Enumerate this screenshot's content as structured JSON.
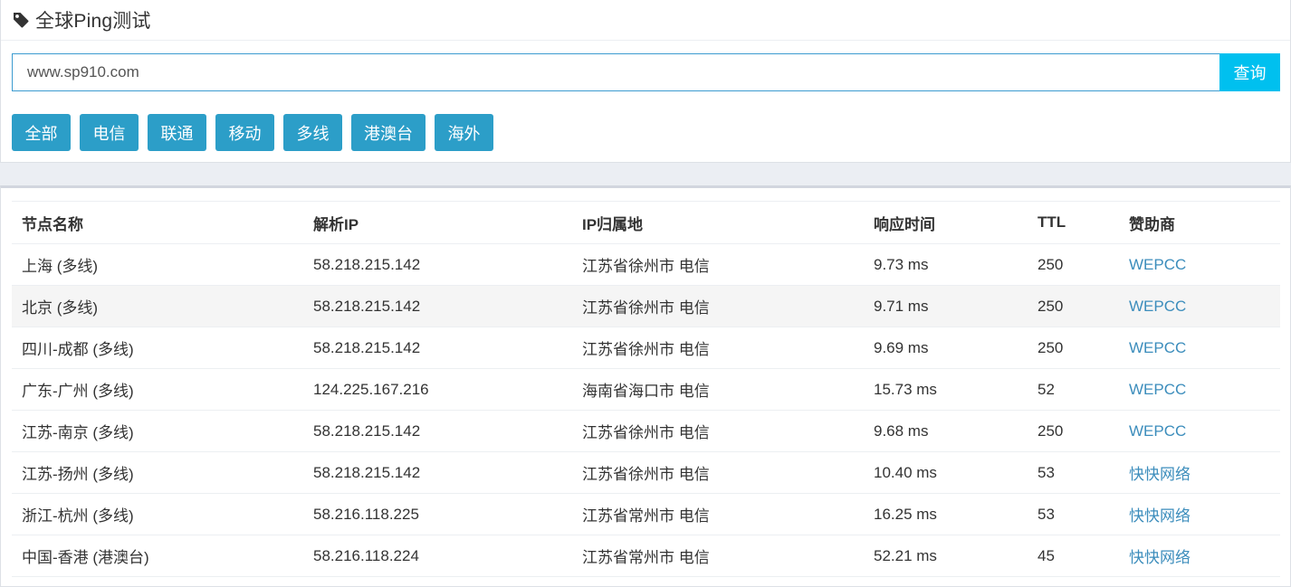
{
  "header": {
    "title": "全球Ping测试",
    "icon": "tag-icon"
  },
  "search": {
    "value": "www.sp910.com",
    "button_label": "查询"
  },
  "filters": [
    "全部",
    "电信",
    "联通",
    "移动",
    "多线",
    "港澳台",
    "海外"
  ],
  "colors": {
    "accent": "#00c0ef",
    "filter_button": "#2c9ec8",
    "link": "#3c8dbc",
    "input_border": "#3c9bd0"
  },
  "table": {
    "columns": [
      "节点名称",
      "解析IP",
      "IP归属地",
      "响应时间",
      "TTL",
      "赞助商"
    ],
    "rows": [
      [
        "上海 (多线)",
        "58.218.215.142",
        "江苏省徐州市 电信",
        "9.73 ms",
        "250",
        "WEPCC"
      ],
      [
        "北京 (多线)",
        "58.218.215.142",
        "江苏省徐州市 电信",
        "9.71 ms",
        "250",
        "WEPCC"
      ],
      [
        "四川-成都 (多线)",
        "58.218.215.142",
        "江苏省徐州市 电信",
        "9.69 ms",
        "250",
        "WEPCC"
      ],
      [
        "广东-广州 (多线)",
        "124.225.167.216",
        "海南省海口市 电信",
        "15.73 ms",
        "52",
        "WEPCC"
      ],
      [
        "江苏-南京 (多线)",
        "58.218.215.142",
        "江苏省徐州市 电信",
        "9.68 ms",
        "250",
        "WEPCC"
      ],
      [
        "江苏-扬州 (多线)",
        "58.218.215.142",
        "江苏省徐州市 电信",
        "10.40 ms",
        "53",
        "快快网络"
      ],
      [
        "浙江-杭州 (多线)",
        "58.216.118.225",
        "江苏省常州市 电信",
        "16.25 ms",
        "53",
        "快快网络"
      ],
      [
        "中国-香港 (港澳台)",
        "58.216.118.224",
        "江苏省常州市 电信",
        "52.21 ms",
        "45",
        "快快网络"
      ]
    ]
  }
}
